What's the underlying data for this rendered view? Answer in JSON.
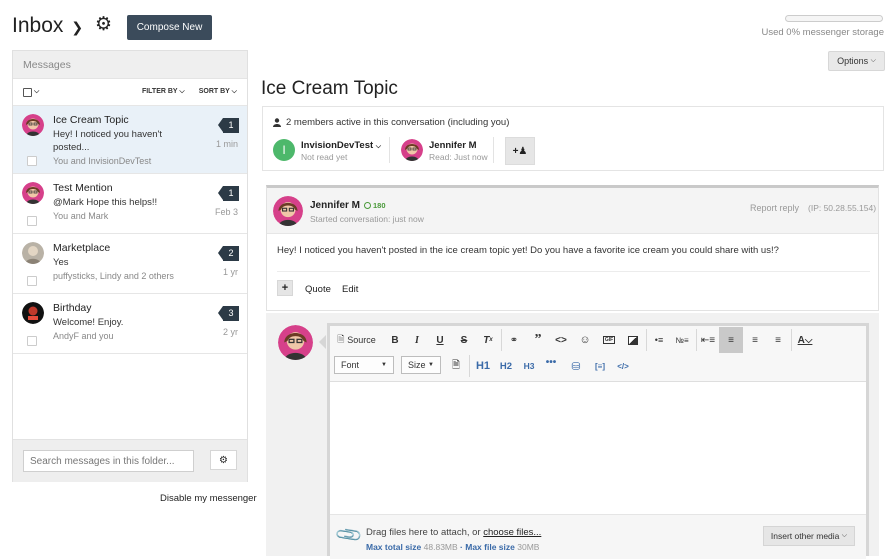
{
  "header": {
    "title": "Inbox",
    "compose_label": "Compose New",
    "storage_text": "Used 0% messenger storage",
    "storage_percent": 0,
    "options_label": "Options"
  },
  "sidebar": {
    "heading": "Messages",
    "filter_label": "FILTER BY",
    "sort_label": "SORT BY",
    "search_placeholder": "Search messages in this folder...",
    "disable_label": "Disable my messenger",
    "messages": [
      {
        "title": "Ice Cream Topic",
        "snippet": "Hey! I noticed you haven't posted...",
        "people": "You and InvisionDevTest",
        "count": "1",
        "when": "1 min"
      },
      {
        "title": "Test Mention",
        "snippet": "@Mark Hope this helps!!",
        "people": "You and Mark",
        "count": "1",
        "when": "Feb 3"
      },
      {
        "title": "Marketplace",
        "snippet": "Yes",
        "people": "puffysticks, Lindy and 2 others",
        "count": "2",
        "when": "1 yr"
      },
      {
        "title": "Birthday",
        "snippet": "Welcome! Enjoy.",
        "people": "AndyF and you",
        "count": "3",
        "when": "2 yr"
      }
    ]
  },
  "conversation": {
    "title": "Ice Cream Topic",
    "members_text": "2 members active in this conversation (including you)",
    "members": [
      {
        "initial": "I",
        "name": "InvisionDevTest",
        "status": "Not read yet"
      },
      {
        "name": "Jennifer M",
        "status": "Read: Just now"
      }
    ],
    "post": {
      "author": "Jennifer M",
      "reputation": "180",
      "started": "Started conversation: just now",
      "report_label": "Report reply",
      "ip": "(IP: 50.28.55.154)",
      "body": "Hey! I noticed you haven't posted in the ice cream topic yet! Do you have a favorite ice cream you could share with us!?",
      "quote_label": "Quote",
      "edit_label": "Edit"
    },
    "editor": {
      "source_label": "Source",
      "font_label": "Font",
      "size_label": "Size",
      "h1": "H1",
      "h2": "H2",
      "h3": "H3",
      "drag_text": "Drag files here to attach, or",
      "choose_files": "choose files...",
      "max_total_label": "Max total size",
      "max_total_value": "48.83MB",
      "max_file_label": "Max file size",
      "max_file_value": "30MB",
      "insert_media_label": "Insert other media"
    }
  },
  "colors": {
    "compose_bg": "#3b4b5b",
    "badge_bg": "#2c3a46",
    "active_row": "#e9f1f8",
    "member_green": "#4db86b",
    "avatar_pink": "#d6408a",
    "link_blue": "#3a6aa8"
  }
}
